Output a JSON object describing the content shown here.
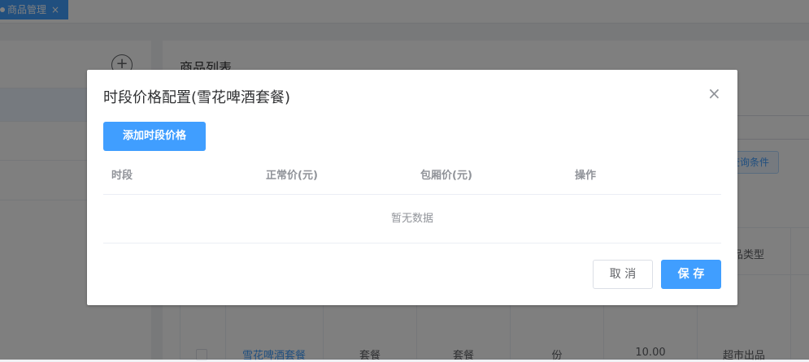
{
  "tabs": [
    {
      "label": "商品管理",
      "close_icon": "×"
    }
  ],
  "left_panel": {
    "add_icon": "+"
  },
  "product_list": {
    "title": "商品列表",
    "filter_button": "查询条件",
    "headers": {
      "category": "商品类型"
    },
    "row": {
      "name": "雪花啤酒套餐",
      "type": "套餐",
      "spec": "套餐",
      "unit": "份",
      "price": "10.00",
      "category": "超市出品"
    }
  },
  "dialog": {
    "title": "时段价格配置(雪花啤酒套餐)",
    "close_icon": "×",
    "add_button": "添加时段价格",
    "columns": [
      "时段",
      "正常价(元)",
      "包厢价(元)",
      "操作"
    ],
    "empty_text": "暂无数据",
    "cancel_button": "取 消",
    "save_button": "保 存"
  },
  "colors": {
    "primary": "#409eff",
    "mask": "rgba(0,0,0,0.5)"
  }
}
